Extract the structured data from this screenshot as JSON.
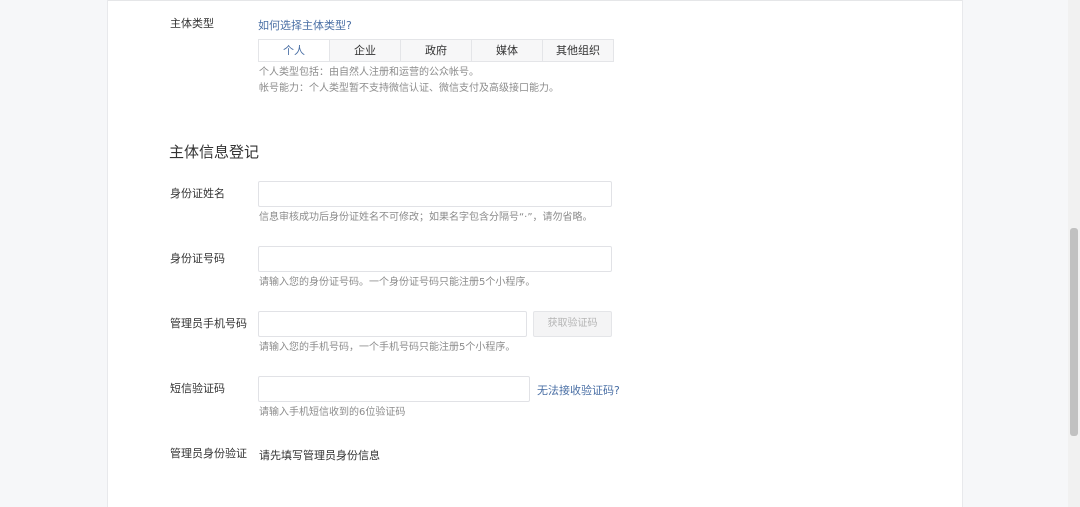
{
  "entity_type": {
    "label": "主体类型",
    "help_link": "如何选择主体类型?",
    "options": [
      "个人",
      "企业",
      "政府",
      "媒体",
      "其他组织"
    ],
    "selected": "个人",
    "hint_line1": "个人类型包括：由自然人注册和运营的公众帐号。",
    "hint_line2": "帐号能力：个人类型暂不支持微信认证、微信支付及高级接口能力。"
  },
  "section": {
    "title": "主体信息登记"
  },
  "id_name": {
    "label": "身份证姓名",
    "value": "",
    "hint": "信息审核成功后身份证姓名不可修改；如果名字包含分隔号“·”，请勿省略。"
  },
  "id_number": {
    "label": "身份证号码",
    "value": "",
    "hint": "请输入您的身份证号码。一个身份证号码只能注册5个小程序。"
  },
  "phone": {
    "label": "管理员手机号码",
    "value": "",
    "button": "获取验证码",
    "hint": "请输入您的手机号码，一个手机号码只能注册5个小程序。"
  },
  "sms_code": {
    "label": "短信验证码",
    "value": "",
    "help_link": "无法接收验证码?",
    "hint": "请输入手机短信收到的6位验证码"
  },
  "admin_verify": {
    "label": "管理员身份验证",
    "text": "请先填写管理员身份信息"
  }
}
